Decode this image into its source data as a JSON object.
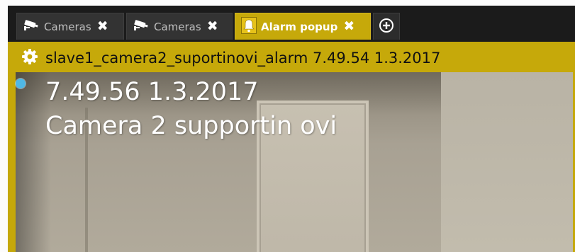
{
  "tabs": [
    {
      "label": "Cameras",
      "icon": "cctv-camera-icon",
      "close": "✖",
      "active": false
    },
    {
      "label": "Cameras",
      "icon": "cctv-camera-icon",
      "close": "✖",
      "active": false
    },
    {
      "label": "Alarm popup",
      "icon": "bell-icon",
      "close": "✖",
      "active": true
    }
  ],
  "add_tab": {
    "icon": "plus-circle-icon"
  },
  "panel": {
    "settings_icon": "gear-icon",
    "title": "slave1_camera2_suportinovi_alarm 7.49.54  1.3.2017"
  },
  "video": {
    "status_dot_color": "#4fb8e6",
    "overlay_time": "7.49.56  1.3.2017",
    "overlay_name": "Camera 2 supportin ovi"
  },
  "colors": {
    "accent": "#c6a90a",
    "tab_bg": "#333333",
    "background": "#1b1b1b"
  }
}
